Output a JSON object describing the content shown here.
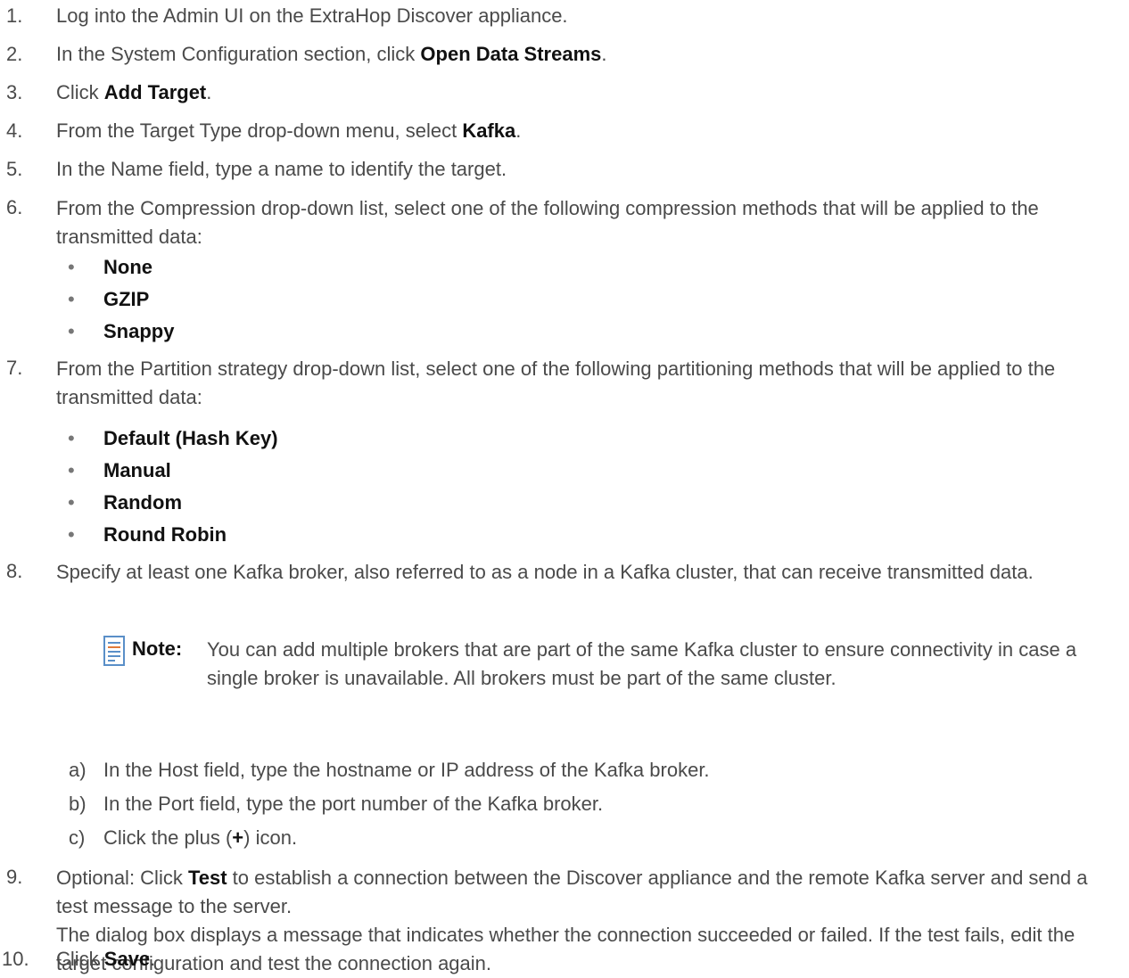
{
  "steps": [
    {
      "num": "1.",
      "pre": "Log into the Admin UI on the ExtraHop Discover appliance.",
      "bold": "",
      "post": ""
    },
    {
      "num": "2.",
      "pre": "In the System Configuration section, click ",
      "bold": "Open Data Streams",
      "post": "."
    },
    {
      "num": "3.",
      "pre": "Click ",
      "bold": "Add Target",
      "post": "."
    },
    {
      "num": "4.",
      "pre": "From the Target Type drop-down menu, select ",
      "bold": "Kafka",
      "post": "."
    },
    {
      "num": "5.",
      "pre": "In the Name field, type a name to identify the target.",
      "bold": "",
      "post": ""
    },
    {
      "num": "6.",
      "text": "From the Compression drop-down list, select one of the following compression methods that will be applied to the transmitted data:"
    },
    {
      "num": "7.",
      "text": "From the Partition strategy drop-down list, select one of the following partitioning methods that will be applied to the transmitted data:"
    },
    {
      "num": "8.",
      "text": "Specify at least one Kafka broker, also referred to as a node in a Kafka cluster, that can receive transmitted data."
    },
    {
      "num": "9.",
      "pre": "Optional: Click ",
      "bold": "Test",
      "post": " to establish a connection between the Discover appliance and the remote Kafka server and send a test message to the server.",
      "extra": "The dialog box displays a message that indicates whether the connection succeeded or failed. If the test fails, edit the target configuration and test the connection again."
    },
    {
      "num": "10.",
      "pre": "Click ",
      "bold": "Save",
      "post": "."
    }
  ],
  "compression_options": [
    "None",
    "GZIP",
    "Snappy"
  ],
  "partition_options": [
    "Default (Hash Key)",
    "Manual",
    "Random",
    "Round Robin"
  ],
  "bullet_glyph": "•",
  "note": {
    "label": "Note:",
    "text": "You can add multiple brokers that are part of the same Kafka cluster to ensure connectivity in case a single broker is unavailable. All brokers must be part of the same cluster.",
    "icon": "note-icon"
  },
  "substeps": [
    {
      "num": "a)",
      "pre": "In the Host field, type the hostname or IP address of the Kafka broker.",
      "bold": "",
      "post": ""
    },
    {
      "num": "b)",
      "pre": "In the Port field, type the port number of the Kafka broker.",
      "bold": "",
      "post": ""
    },
    {
      "num": "c)",
      "pre": "Click the plus (",
      "bold": "+",
      "post": ") icon."
    }
  ],
  "colors": {
    "text": "#4a4a4a",
    "bold": "#111111",
    "note_icon": "#5a8fc8"
  }
}
